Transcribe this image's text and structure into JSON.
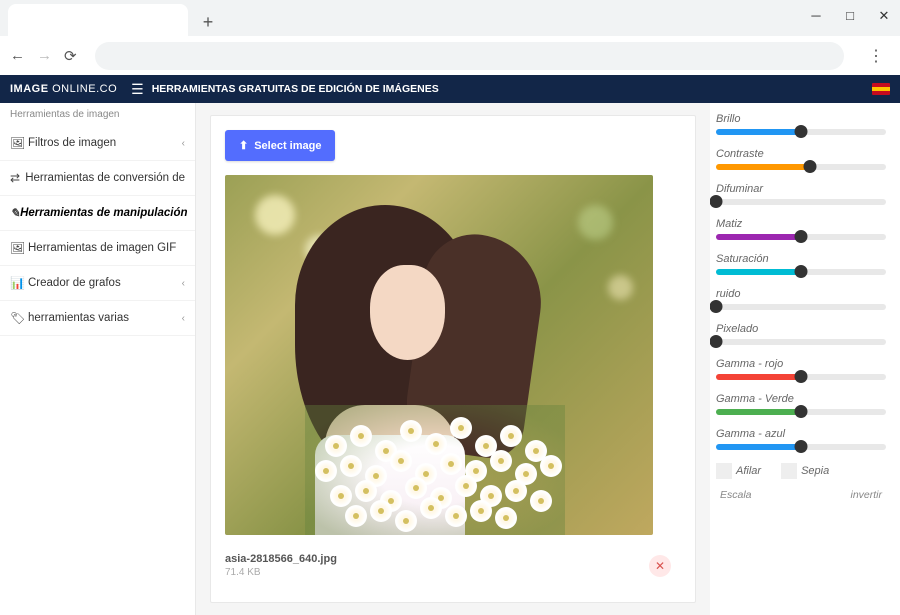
{
  "header": {
    "logo_bold": "IMAGE",
    "logo_thin": " ONLINE.CO",
    "title": "HERRAMIENTAS GRATUITAS DE EDICIÓN DE IMÁGENES"
  },
  "sidebar": {
    "section_label": "Herramientas de imagen",
    "items": [
      {
        "icon": "image",
        "label": "Filtros de imagen",
        "chevron": true,
        "active": false
      },
      {
        "icon": "shuffle",
        "label": "Herramientas de conversión de",
        "chevron": false,
        "active": false
      },
      {
        "icon": "wrench",
        "label": "Herramientas de manipulación",
        "chevron": false,
        "active": true
      },
      {
        "icon": "gif",
        "label": "Herramientas de imagen GIF",
        "chevron": false,
        "active": false
      },
      {
        "icon": "chart",
        "label": "Creador de grafos",
        "chevron": true,
        "active": false
      },
      {
        "icon": "tags",
        "label": "herramientas varias",
        "chevron": true,
        "active": false
      }
    ]
  },
  "main": {
    "select_button": "Select image",
    "filename": "asia-2818566_640.jpg",
    "filesize": "71.4 KB"
  },
  "sliders": [
    {
      "label": "Brillo",
      "color": "#2196f3",
      "value": 50
    },
    {
      "label": "Contraste",
      "color": "#ff9800",
      "value": 55
    },
    {
      "label": "Difuminar",
      "color": "#888",
      "value": 0
    },
    {
      "label": "Matiz",
      "color": "#9c27b0",
      "value": 50
    },
    {
      "label": "Saturación",
      "color": "#00bcd4",
      "value": 50
    },
    {
      "label": "ruido",
      "color": "#888",
      "value": 0
    },
    {
      "label": "Pixelado",
      "color": "#888",
      "value": 0
    },
    {
      "label": "Gamma - rojo",
      "color": "#f44336",
      "value": 50
    },
    {
      "label": "Gamma - Verde",
      "color": "#4caf50",
      "value": 50
    },
    {
      "label": "Gamma - azul",
      "color": "#2196f3",
      "value": 50
    }
  ],
  "checkboxes": {
    "sharpen": "Afilar",
    "sepia": "Sepia"
  },
  "bottom": {
    "scale": "Escala",
    "invert": "invertir"
  }
}
